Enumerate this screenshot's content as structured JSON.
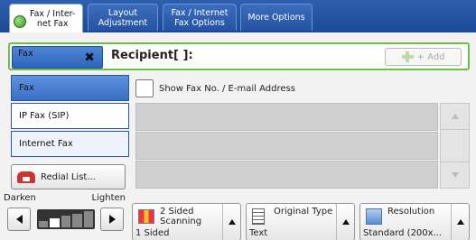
{
  "tabs": [
    {
      "label": "Fax / Inter-\nnet Fax",
      "active": true
    },
    {
      "label": "Layout\nAdjustment",
      "active": false
    },
    {
      "label": "Fax / Internet\nFax Options",
      "active": false
    },
    {
      "label": "More Options",
      "active": false
    }
  ],
  "address_bar": {
    "fax_type_label": "Fax",
    "clear_symbol": "✖",
    "recipient_label": "Recipient[   ]:",
    "add_label": "+ Add"
  },
  "fax_type_menu": {
    "items": [
      "Fax",
      "IP Fax (SIP)",
      "Internet Fax"
    ],
    "selected": "Fax"
  },
  "redial_label": "Redial List...",
  "show_fax_label": "Show Fax No. / E-mail Address",
  "darkness": {
    "left_label": "Darken",
    "right_label": "Lighten",
    "level": 2,
    "max_level": 5
  },
  "features": [
    {
      "title": "2 Sided\nScanning",
      "value": "1 Sided",
      "icon": "duplex-icon"
    },
    {
      "title": "Original Type",
      "value": "Text",
      "icon": "document-icon"
    },
    {
      "title": "Resolution",
      "value": "Standard (200x...",
      "icon": "resolution-icon"
    }
  ],
  "colors": {
    "accent_blue": "#2d64bb",
    "highlight_green": "#6cc143"
  }
}
